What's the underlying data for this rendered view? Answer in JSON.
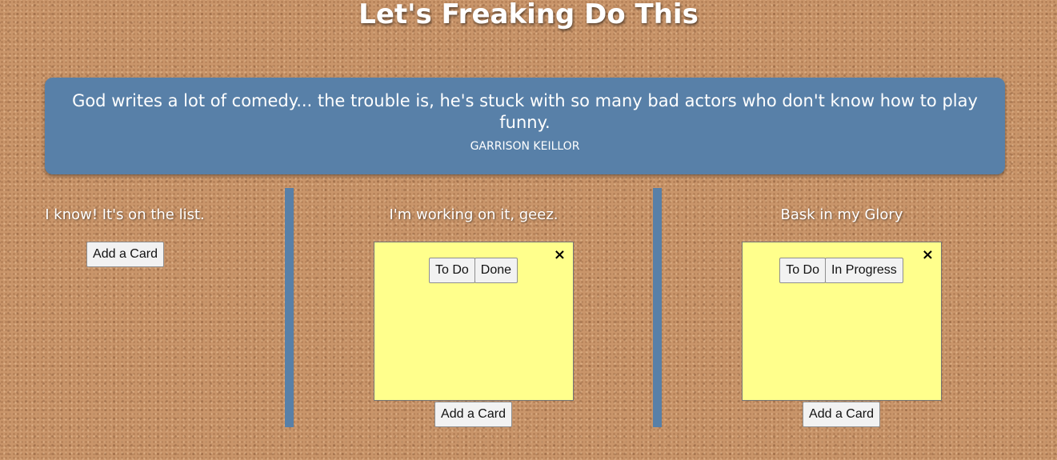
{
  "page": {
    "title": "Let's Freaking Do This"
  },
  "quote": {
    "text": "God writes a lot of comedy... the trouble is, he's stuck with so many bad actors who don't know how to play funny.",
    "author": "GARRISON KEILLOR"
  },
  "columns": [
    {
      "heading": "I know! It's on the list.",
      "add_label": "Add a Card",
      "cards": []
    },
    {
      "heading": "I'm working on it, geez.",
      "add_label": "Add a Card",
      "cards": [
        {
          "move_buttons": [
            "To Do",
            "Done"
          ],
          "close_icon": "×"
        }
      ]
    },
    {
      "heading": "Bask in my Glory",
      "add_label": "Add a Card",
      "cards": [
        {
          "move_buttons": [
            "To Do",
            "In Progress"
          ],
          "close_icon": "×"
        }
      ]
    }
  ],
  "colors": {
    "accent": "#5880a8",
    "note": "#ffff8c",
    "corkboard": "#c9956a"
  }
}
